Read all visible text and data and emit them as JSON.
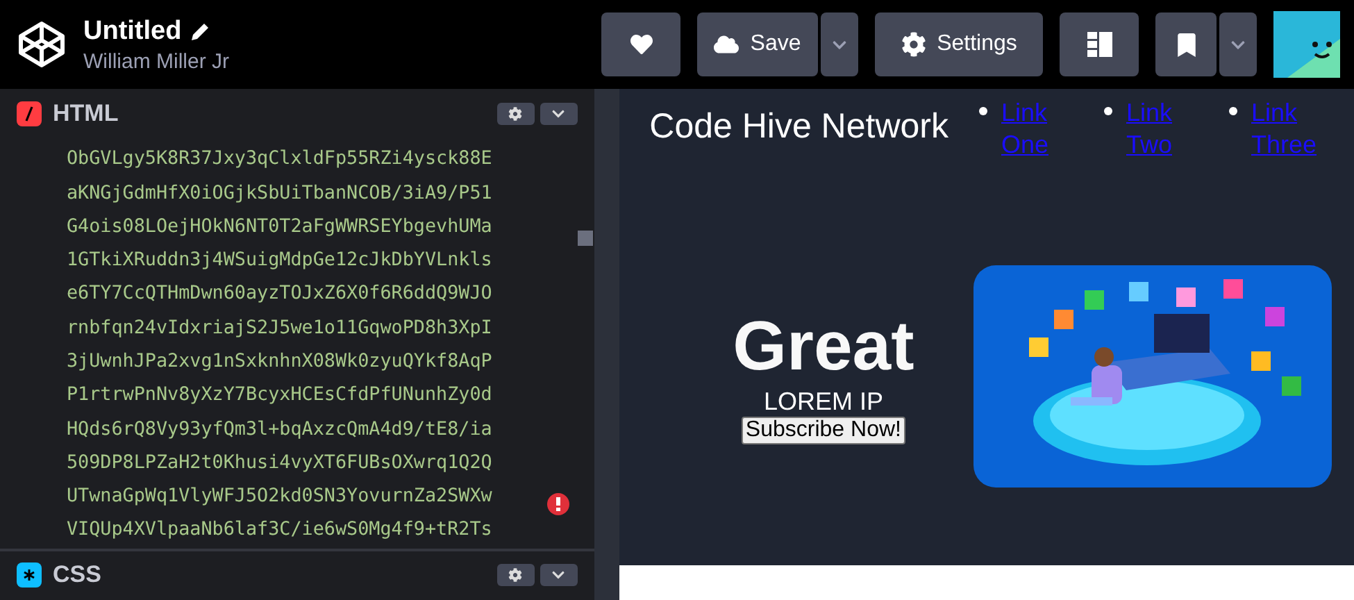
{
  "header": {
    "title": "Untitled",
    "author": "William Miller Jr",
    "save_label": "Save",
    "settings_label": "Settings"
  },
  "editors": [
    {
      "kind": "html",
      "label": "HTML",
      "error": true,
      "lines": [
        "ObGVLgy5K8R37Jxy3qClxldFp55RZi4ysck88E",
        "aKNGjGdmHfX0iOGjkSbUiTbanNCOB/3iA9/P51",
        "G4ois08LOejHOkN6NT0T2aFgWWRSEYbgevhUMa",
        "1GTkiXRuddn3j4WSuigMdpGe12cJkDbYVLnkls",
        "e6TY7CcQTHmDwn60ayzTOJxZ6X0f6R6ddQ9WJO",
        "rnbfqn24vIdxriajS2J5we1o11GqwoPD8h3XpI",
        "3jUwnhJPa2xvg1nSxknhnX08Wk0zyuQYkf8AqP",
        "P1rtrwPnNv8yXzY7BcyxHCEsCfdPfUNunhZy0d",
        "HQds6rQ8Vy93yfQm3l+bqAxzcQmA4d9/tE8/ia",
        "509DP8LPZaH2t0Khusi4vyXT6FUBsOXwrq1Q2Q",
        "UTwnaGpWq1VlyWFJ5O2kd0SN3YovurnZa2SWXw",
        "VIQUp4XVlpaaNb6laf3C/ie6wS0Mg4f9+tR2Ts"
      ]
    },
    {
      "kind": "css",
      "label": "CSS"
    }
  ],
  "preview": {
    "brand": "Code Hive Network",
    "links": [
      "Link One",
      "Link Two",
      "Link Three"
    ],
    "hero": {
      "heading": "Great",
      "subtitle": "LOREM IP",
      "button": "Subscribe Now!"
    }
  }
}
